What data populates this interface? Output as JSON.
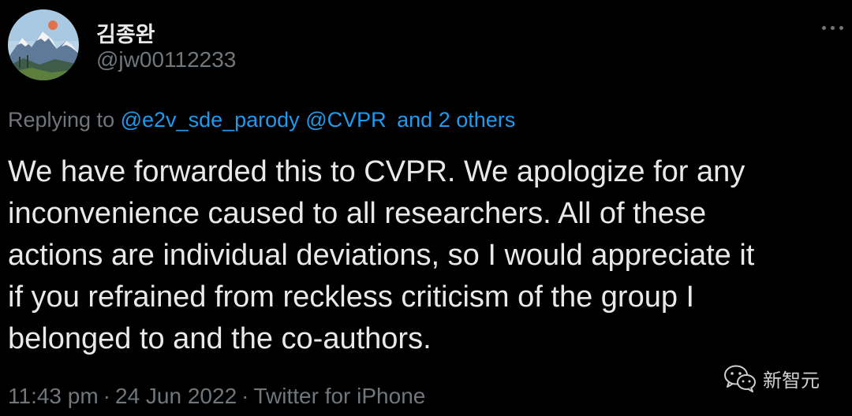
{
  "author": {
    "display_name": "김종완",
    "handle": "@jw00112233",
    "avatar_icon": "mountain-landscape-avatar"
  },
  "more_icon": "more-options-icon",
  "reply": {
    "prefix": "Replying to",
    "mention_1": "@e2v_sde_parody",
    "mention_2": "@CVPR",
    "others": "and 2 others"
  },
  "body": "We have forwarded this to CVPR. We apologize for any\ninconvenience caused to all researchers.  All of these\nactions are individual deviations, so I would appreciate it\nif you refrained from reckless criticism of the group I\nbelonged to and the co-authors.",
  "meta": {
    "time": "11:43 pm",
    "separator": "·",
    "date": "24 Jun 2022",
    "source": "Twitter for iPhone"
  },
  "watermark": {
    "icon": "wechat-icon",
    "text": "新智元"
  },
  "colors": {
    "background": "#000000",
    "text": "#e7e9ea",
    "muted": "#71767b",
    "link": "#1d9bf0"
  }
}
